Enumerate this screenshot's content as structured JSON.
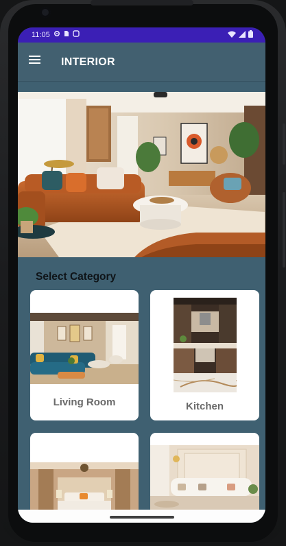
{
  "status_bar": {
    "time": "11:05",
    "icons": [
      "gear-icon",
      "sim-icon",
      "record-icon",
      "wifi-icon",
      "signal-icon",
      "battery-icon"
    ]
  },
  "app_bar": {
    "menu_icon": "hamburger-menu-icon",
    "title": "INTERIOR"
  },
  "hero": {
    "image": "living-room-hero-photo"
  },
  "section": {
    "title": "Select Category"
  },
  "categories": [
    {
      "label": "Living Room",
      "image": "living-room-photo"
    },
    {
      "label": "Kitchen",
      "image": "kitchen-photo"
    },
    {
      "label": "",
      "image": "bedroom-photo"
    },
    {
      "label": "",
      "image": "lounge-photo"
    }
  ],
  "colors": {
    "status_bar": "#3b1fb5",
    "app_bar": "#426070",
    "background": "#3f6071",
    "card": "#ffffff",
    "card_label": "#6a6a6a"
  }
}
